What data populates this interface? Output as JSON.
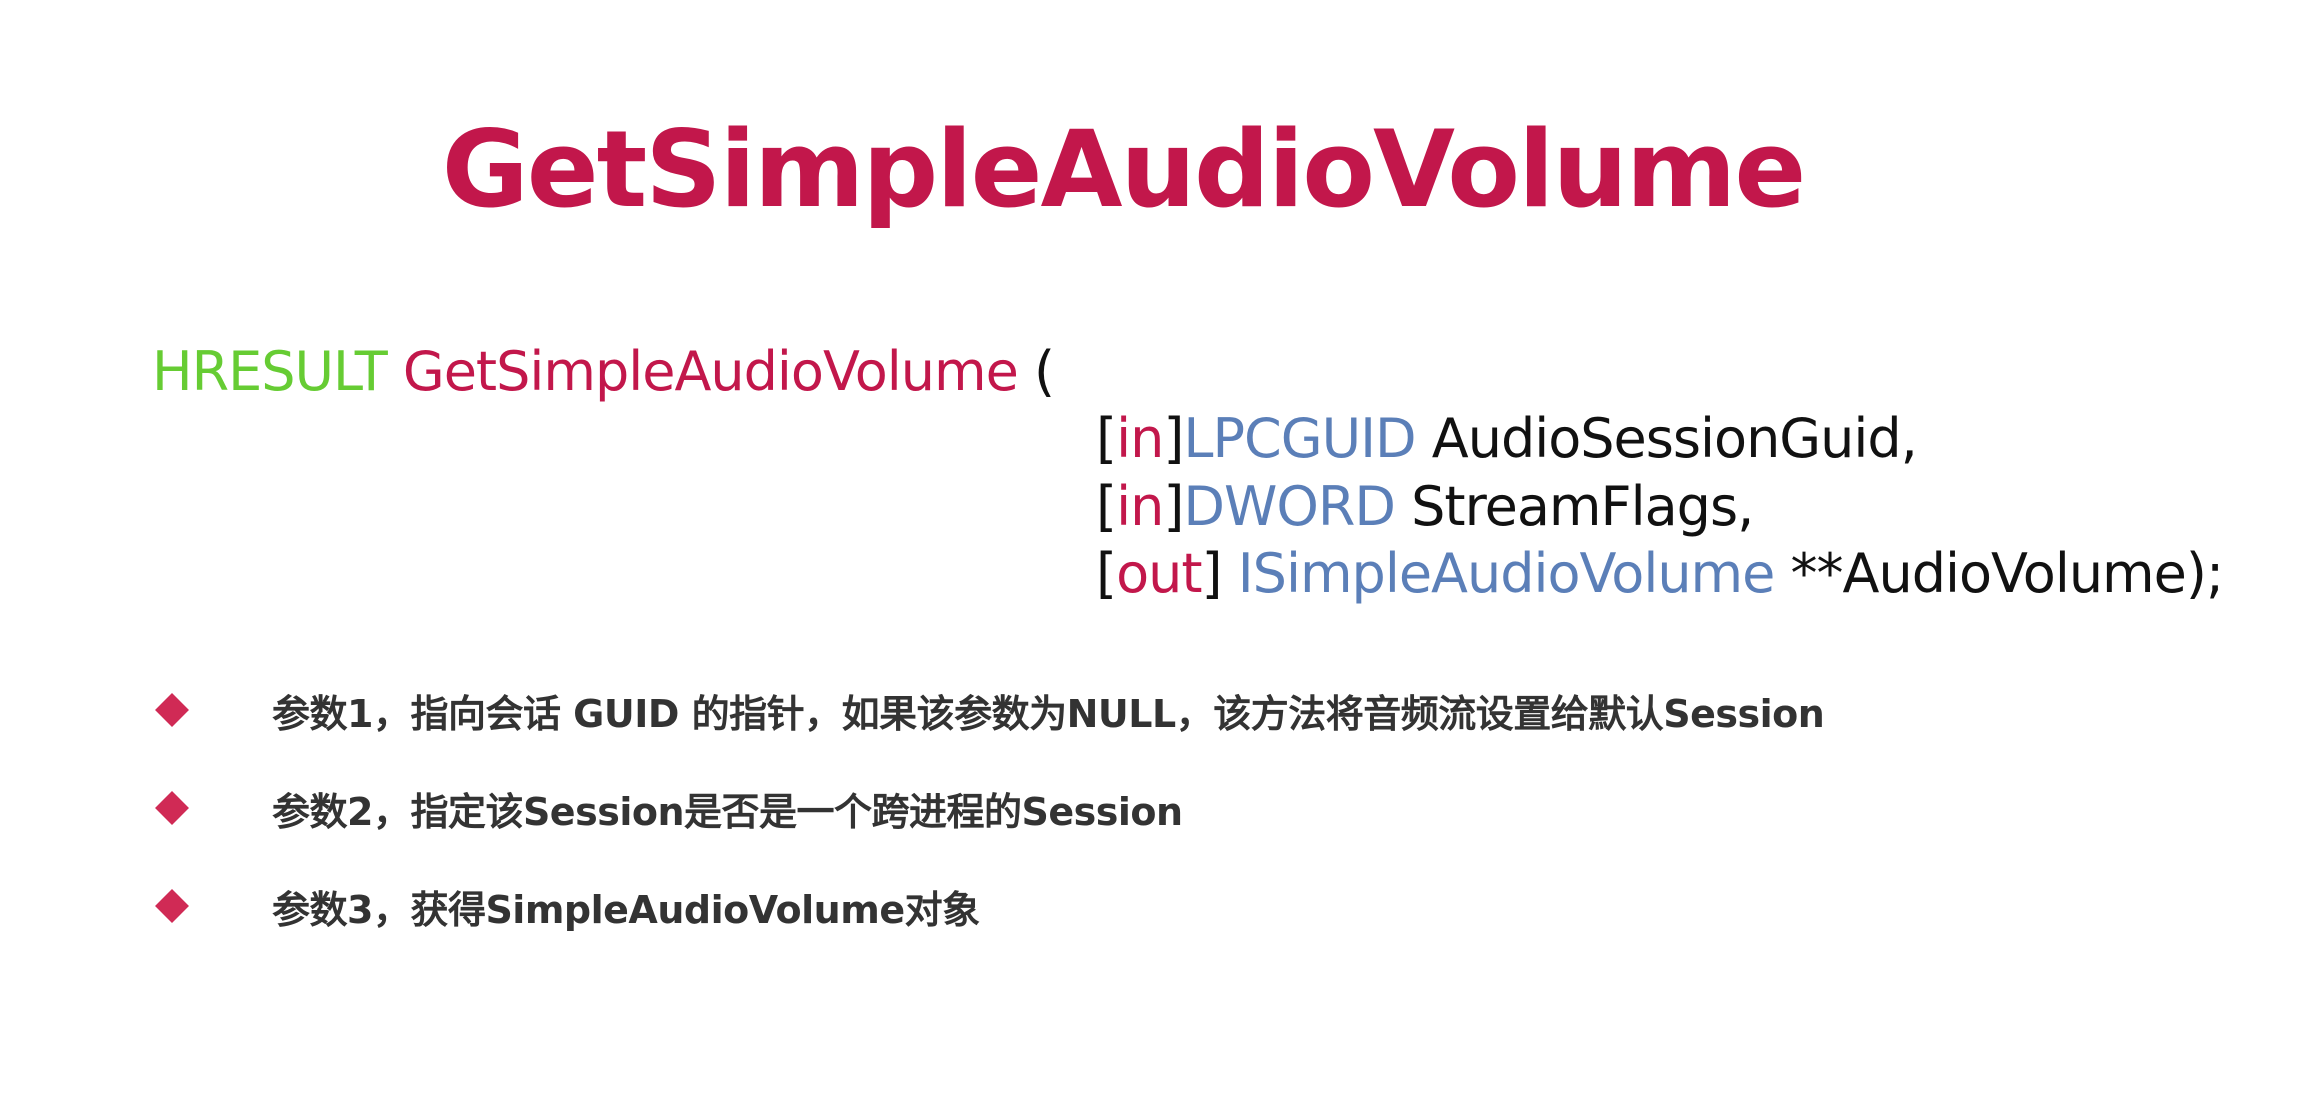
{
  "colors": {
    "title": "#c2174b",
    "keyword_green": "#66cc33",
    "function_red": "#c2174b",
    "type_blue": "#5b7fb8",
    "plain": "#111111",
    "bullet": "#d02a55",
    "bullet_text": "#333333"
  },
  "title": "GetSimpleAudioVolume",
  "signature": {
    "return_type": "HRESULT",
    "function_name": "GetSimpleAudioVolume",
    "open_paren": " ("
  },
  "params": [
    {
      "open": "[",
      "direction": "in",
      "close": "]",
      "type": "LPCGUID",
      "rest": " AudioSessionGuid,"
    },
    {
      "open": "[",
      "direction": "in",
      "close": "]",
      "type": "DWORD",
      "rest": " StreamFlags,"
    },
    {
      "open": "[",
      "direction": "out",
      "close": "] ",
      "type": "ISimpleAudioVolume",
      "rest": " **AudioVolume);"
    }
  ],
  "bullets": [
    {
      "text": "参数1，指向会话 GUID 的指针，如果该参数为NULL，该方法将音频流设置给默认Session"
    },
    {
      "text": "参数2，指定该Session是否是一个跨进程的Session"
    },
    {
      "text": "参数3，获得SimpleAudioVolume对象"
    }
  ]
}
